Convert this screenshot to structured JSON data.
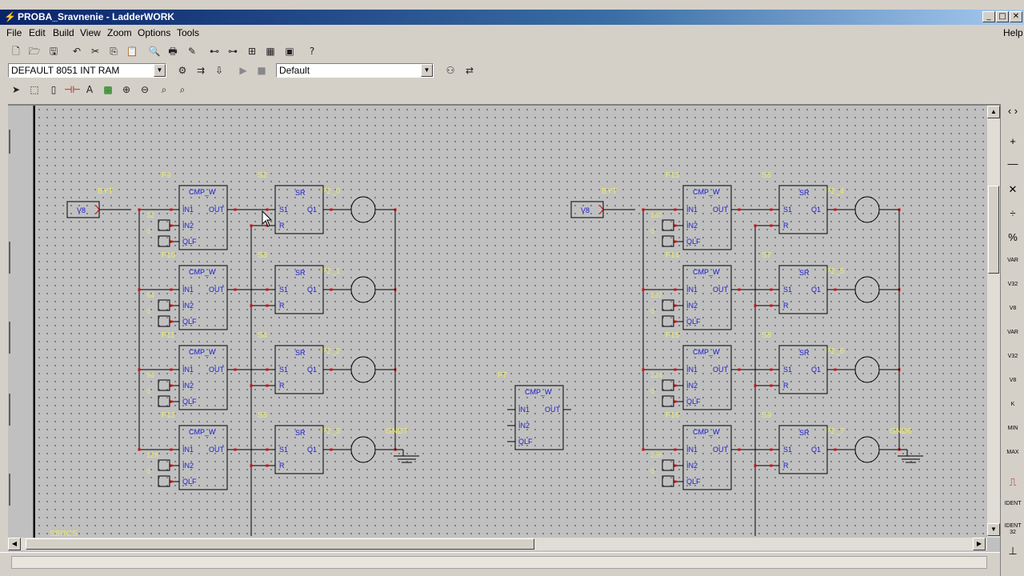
{
  "window": {
    "title": "PROBA_Sravnenie - LadderWORK",
    "minimize": "_",
    "maximize": "□",
    "close": "✕"
  },
  "menu": {
    "file": "File",
    "edit": "Edit",
    "build": "Build",
    "view": "View",
    "zoom": "Zoom",
    "options": "Options",
    "tools": "Tools",
    "help": "Help"
  },
  "toolbar2": {
    "target_combo": "DEFAULT 8051 INT RAM",
    "config_combo": "Default"
  },
  "palette": {
    "var": "VAR",
    "v32": "V32",
    "v8": "V8",
    "var2": "VAR",
    "v32b": "V32",
    "v8b": "V8",
    "k": "K",
    "min": "MIN",
    "max": "MAX",
    "ident": "IDENT",
    "ident32": "IDENT 32"
  },
  "diagram": {
    "byt": "BYT",
    "v8": "V8",
    "cmp": "CMP_W",
    "sr": "SR",
    "in1": "IN1",
    "in2": "IN2",
    "qlf": "QLF",
    "out": "OUT",
    "s1": "S1",
    "r": "R",
    "q1": "Q1",
    "gnd_left": "GND7",
    "gnd_right": "GND6",
    "sbros": "SBROS",
    "f_center": "F7",
    "left": {
      "f": [
        "F9",
        "F10",
        "F11",
        "F12"
      ],
      "s": [
        "S2",
        "S3",
        "S4",
        "S5"
      ],
      "p": [
        "P2_0",
        "P2_1",
        "P2_2",
        "P2_3"
      ],
      "k": [
        "32",
        "64",
        "96",
        "128"
      ]
    },
    "right": {
      "f": [
        "F13",
        "F14",
        "F15",
        "F16"
      ],
      "s": [
        "S6",
        "S7",
        "S8",
        "S9"
      ],
      "p": [
        "P2_4",
        "P2_5",
        "P2_6",
        "P2_7"
      ],
      "k": [
        "160",
        "192",
        "224",
        "256"
      ]
    },
    "zero": "0"
  }
}
